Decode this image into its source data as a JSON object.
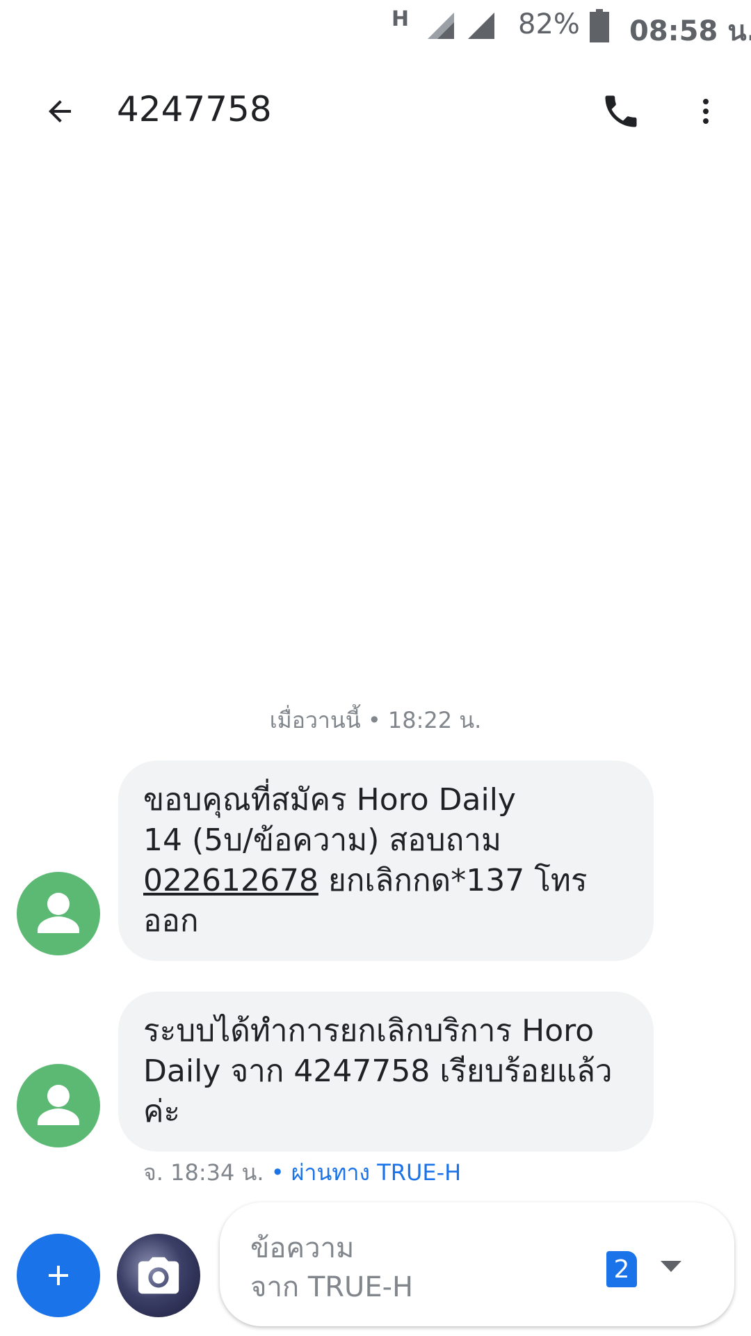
{
  "status_bar": {
    "network": "H",
    "battery": "82%",
    "time": "08:58 น."
  },
  "app_bar": {
    "title": "4247758"
  },
  "conversation": {
    "date_separator": "เมื่อวานนี้ • 18:22 น.",
    "messages": [
      {
        "line1": "ขอบคุณที่สมัคร Horo Daily",
        "line2": "14 (5บ/ข้อความ) สอบถาม",
        "phone": "022612678",
        "line3_rest": " ยกเลิกกด*137 โทร",
        "line4": "ออก"
      },
      {
        "line1": "ระบบได้ทำการยกเลิกบริการ Horo",
        "line2": "Daily จาก 4247758 เรียบร้อยแล้ว",
        "line3": "ค่ะ"
      }
    ],
    "meta_time": "จ. 18:34 น.",
    "meta_via": "• ผ่านทาง TRUE-H"
  },
  "composer": {
    "placeholder_line1": "ข้อความ",
    "placeholder_line2": "จาก TRUE-H",
    "sim_number": "2"
  },
  "colors": {
    "accent": "#1a73e8",
    "avatar": "#5bb974",
    "bubble": "#f1f3f4"
  },
  "icons": [
    "back-arrow-icon",
    "phone-icon",
    "more-vert-icon",
    "person-icon",
    "plus-icon",
    "camera-icon",
    "sim-icon",
    "dropdown-icon"
  ]
}
